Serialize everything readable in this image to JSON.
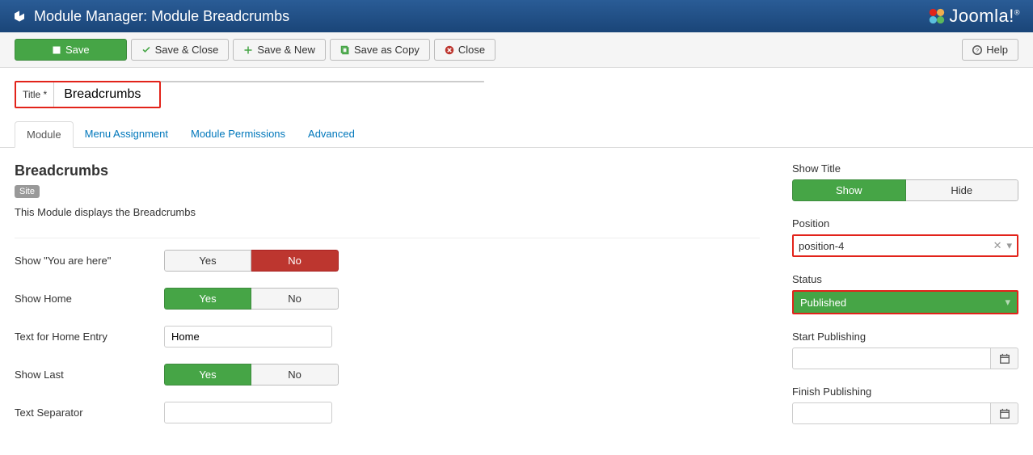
{
  "header": {
    "title": "Module Manager: Module Breadcrumbs",
    "logo_text": "Joomla!"
  },
  "toolbar": {
    "save": "Save",
    "save_close": "Save & Close",
    "save_new": "Save & New",
    "save_copy": "Save as Copy",
    "close": "Close",
    "help": "Help"
  },
  "title_field": {
    "label": "Title *",
    "value": "Breadcrumbs"
  },
  "tabs": {
    "module": "Module",
    "menu_assignment": "Menu Assignment",
    "module_permissions": "Module Permissions",
    "advanced": "Advanced"
  },
  "left": {
    "section_title": "Breadcrumbs",
    "badge": "Site",
    "description": "This Module displays the Breadcrumbs",
    "show_you_are_here": {
      "label": "Show \"You are here\"",
      "yes": "Yes",
      "no": "No"
    },
    "show_home": {
      "label": "Show Home",
      "yes": "Yes",
      "no": "No"
    },
    "text_home": {
      "label": "Text for Home Entry",
      "value": "Home"
    },
    "show_last": {
      "label": "Show Last",
      "yes": "Yes",
      "no": "No"
    },
    "text_separator": {
      "label": "Text Separator",
      "value": ""
    }
  },
  "right": {
    "show_title": {
      "label": "Show Title",
      "show": "Show",
      "hide": "Hide"
    },
    "position": {
      "label": "Position",
      "value": "position-4"
    },
    "status": {
      "label": "Status",
      "value": "Published"
    },
    "start_publishing": {
      "label": "Start Publishing",
      "value": ""
    },
    "finish_publishing": {
      "label": "Finish Publishing",
      "value": ""
    }
  }
}
